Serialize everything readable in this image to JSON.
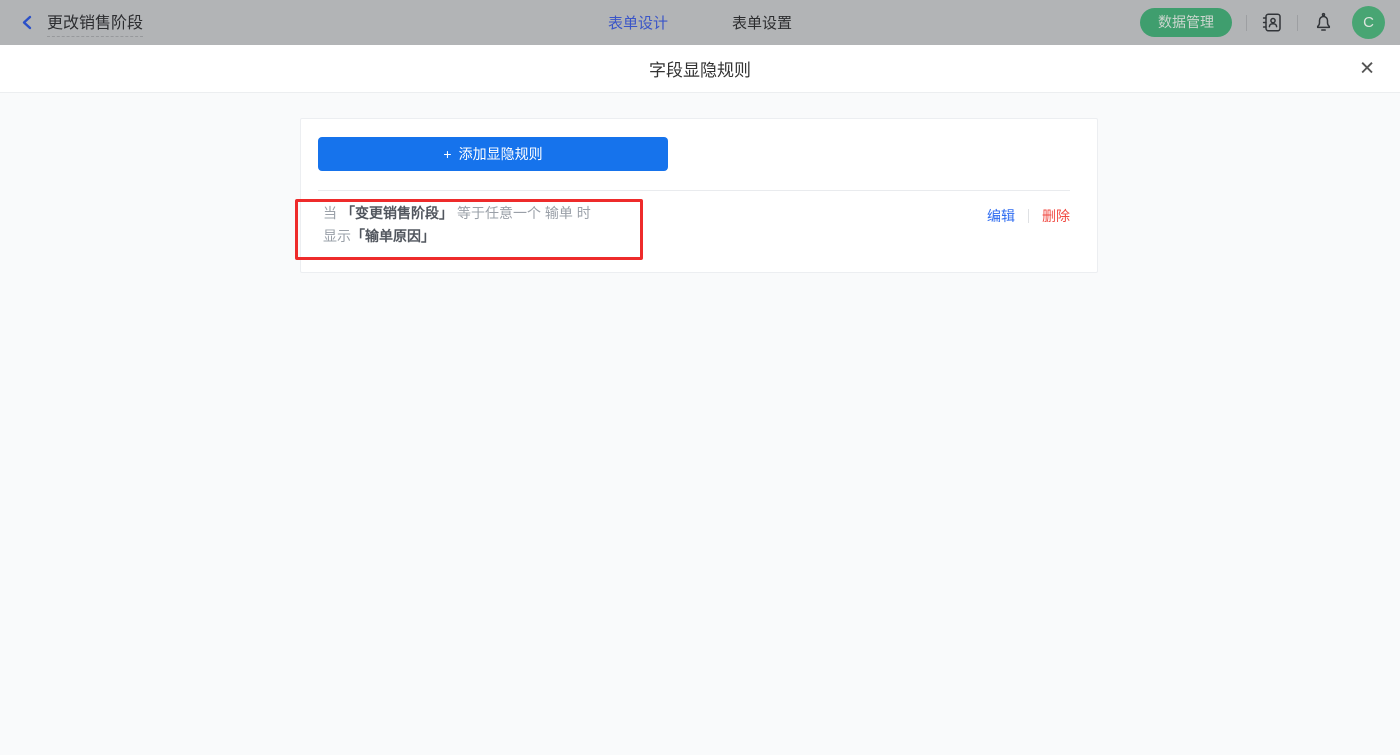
{
  "header": {
    "back_label": "更改销售阶段",
    "tabs": [
      {
        "label": "表单设计",
        "active": true
      },
      {
        "label": "表单设置",
        "active": false
      }
    ],
    "data_manage_label": "数据管理",
    "avatar_letter": "C"
  },
  "modal": {
    "title": "字段显隐规则",
    "close_glyph": "✕"
  },
  "card": {
    "add_button_plus": "+",
    "add_button_label": "添加显隐规则",
    "rule": {
      "when": "当",
      "field1": "「变更销售阶段」",
      "condition": "等于任意一个 输单 时",
      "show": "显示",
      "field2": "「输单原因」",
      "edit_label": "编辑",
      "delete_label": "删除"
    }
  },
  "colors": {
    "primary_blue": "#1673ec",
    "active_tab_blue": "#3a55c8",
    "green_accent": "#3f9e6e",
    "delete_red": "#f04a42",
    "annotation_red": "#ee2b2b",
    "header_dimmed_bg": "#b2b4b6",
    "body_bg": "#f9fafb"
  }
}
